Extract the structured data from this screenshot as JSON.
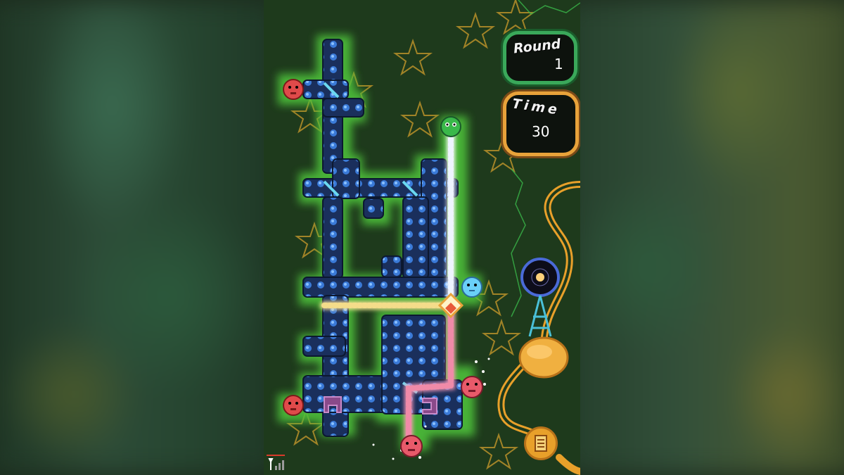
{
  "hud": {
    "round_label": "Round",
    "round_value": "1",
    "time_label": "Time",
    "time_value": "30"
  },
  "icons": {
    "signal": "signal-bars-icon",
    "document": "document-icon",
    "tower": "radio-tower-icon"
  },
  "colors": {
    "background": "#1e3a1c",
    "pipe": "#1e3a6e",
    "glow": "#4ec03a",
    "beam_white": "#e8f0ff",
    "beam_yellow": "#f4dc8a",
    "beam_pink": "#f08aa8",
    "round_border": "#3aa85a",
    "time_border": "#e8a23a",
    "tube": "#e8a02a"
  }
}
